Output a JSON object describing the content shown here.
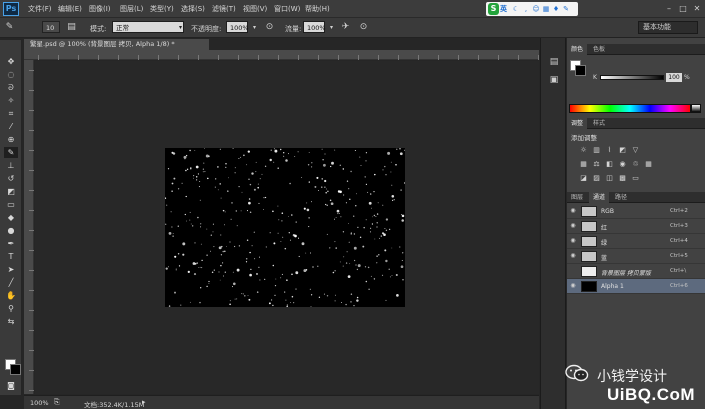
{
  "app": {
    "logo": "Ps"
  },
  "menu": [
    "文件(F)",
    "编辑(E)",
    "图像(I)",
    "图层(L)",
    "类型(Y)",
    "选择(S)",
    "滤镜(T)",
    "视图(V)",
    "窗口(W)",
    "帮助(H)"
  ],
  "ime": {
    "logo": "S",
    "lang": "英"
  },
  "options": {
    "brush_size": "10",
    "mode_label": "模式:",
    "mode_value": "正常",
    "opacity_label": "不透明度:",
    "opacity_value": "100%",
    "flow_label": "流量:",
    "flow_value": "100%",
    "workspace": "基本功能"
  },
  "document": {
    "tab_title": "繁星.psd @ 100% (背景图层 拷贝, Alpha 1/8) *",
    "zoom": "100%",
    "doc_info": "文档:352.4K/1.15M"
  },
  "panels": {
    "color_tabs": [
      "颜色",
      "色板"
    ],
    "k_label": "K",
    "k_value": "100",
    "k_unit": "%",
    "adjust_tabs": [
      "调整",
      "样式"
    ],
    "adjust_title": "添加调整",
    "layer_tabs": [
      "图层",
      "通道",
      "路径"
    ],
    "channels": [
      {
        "name": "RGB",
        "shortcut": "Ctrl+2"
      },
      {
        "name": "红",
        "shortcut": "Ctrl+3"
      },
      {
        "name": "绿",
        "shortcut": "Ctrl+4"
      },
      {
        "name": "蓝",
        "shortcut": "Ctrl+5"
      },
      {
        "name": "背景图层 拷贝蒙版",
        "shortcut": "Ctrl+\\"
      },
      {
        "name": "Alpha 1",
        "shortcut": "Ctrl+6"
      }
    ]
  },
  "watermark": {
    "text": "小钱学设计",
    "brand": "UiBQ.CoM"
  },
  "colors": {
    "accent": "#49a1e7",
    "selected_row": "#5d6a7e",
    "canvas_bg": "#282828"
  }
}
